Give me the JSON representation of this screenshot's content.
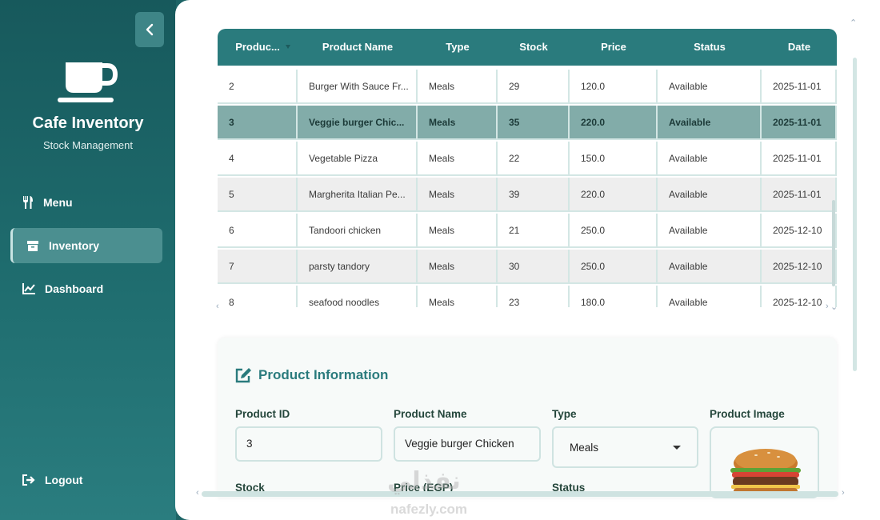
{
  "sidebar": {
    "brand_title": "Cafe Inventory",
    "brand_subtitle": "Stock Management",
    "items": [
      {
        "label": "Menu",
        "icon": "utensils-icon"
      },
      {
        "label": "Inventory",
        "icon": "box-icon",
        "active": true
      },
      {
        "label": "Dashboard",
        "icon": "chart-icon"
      }
    ],
    "logout_label": "Logout"
  },
  "table": {
    "columns": [
      "Produc...",
      "Product Name",
      "Type",
      "Stock",
      "Price",
      "Status",
      "Date"
    ],
    "rows": [
      [
        "2",
        "Burger With Sauce Fr...",
        "Meals",
        "29",
        "120.0",
        "Available",
        "2025-11-01"
      ],
      [
        "3",
        "Veggie burger Chic...",
        "Meals",
        "35",
        "220.0",
        "Available",
        "2025-11-01"
      ],
      [
        "4",
        "Vegetable Pizza",
        "Meals",
        "22",
        "150.0",
        "Available",
        "2025-11-01"
      ],
      [
        "5",
        "Margherita Italian Pe...",
        "Meals",
        "39",
        "220.0",
        "Available",
        "2025-11-01"
      ],
      [
        "6",
        "Tandoori chicken",
        "Meals",
        "21",
        "250.0",
        "Available",
        "2025-12-10"
      ],
      [
        "7",
        "parsty tandory",
        "Meals",
        "30",
        "250.0",
        "Available",
        "2025-12-10"
      ],
      [
        "8",
        "seafood noodles",
        "Meals",
        "23",
        "180.0",
        "Available",
        "2025-12-10"
      ]
    ],
    "selected_row": 1
  },
  "product_info": {
    "title": "Product Information",
    "id_label": "Product ID",
    "id_value": "3",
    "name_label": "Product Name",
    "name_value": "Veggie burger Chicken",
    "type_label": "Type",
    "type_value": "Meals",
    "image_label": "Product Image",
    "stock_label": "Stock",
    "price_label": "Price (EGP)",
    "status_label": "Status"
  },
  "watermark": {
    "arabic": "نفذلي",
    "latin": "nafezly.com"
  },
  "colors": {
    "accent": "#2a7b7d",
    "sidebar": "#1d6466",
    "selected_row": "#82aca9"
  }
}
